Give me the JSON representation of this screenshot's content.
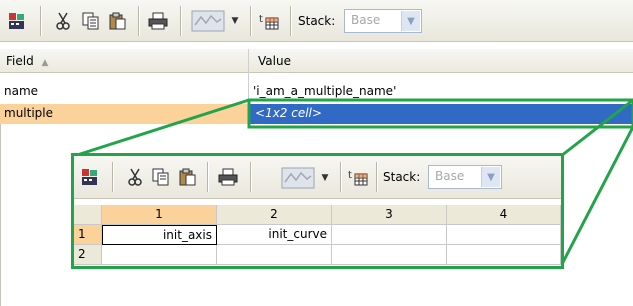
{
  "toolbar": {
    "stack_label": "Stack:",
    "stack_value": "Base",
    "icons": [
      "import-data-icon",
      "cut-icon",
      "copy-icon",
      "paste-icon",
      "print-icon",
      "plot-icon",
      "dropdown-arrow-icon",
      "new-variable-icon"
    ]
  },
  "grid": {
    "headers": {
      "field": "Field",
      "value": "Value"
    },
    "rows": [
      {
        "field": "name",
        "value": "'i_am_a_multiple_name'"
      },
      {
        "field": "multiple",
        "value": "<1x2 cell>"
      }
    ]
  },
  "popup": {
    "toolbar": {
      "stack_label": "Stack:",
      "stack_value": "Base"
    },
    "columns": [
      "1",
      "2",
      "3",
      "4"
    ],
    "rows": [
      {
        "label": "1",
        "cells": [
          "init_axis",
          "init_curve",
          "",
          ""
        ]
      },
      {
        "label": "2",
        "cells": [
          "",
          "",
          "",
          ""
        ]
      }
    ]
  },
  "colors": {
    "highlight": "#316ac5",
    "selection": "#fbd39a",
    "callout": "#23a449"
  }
}
